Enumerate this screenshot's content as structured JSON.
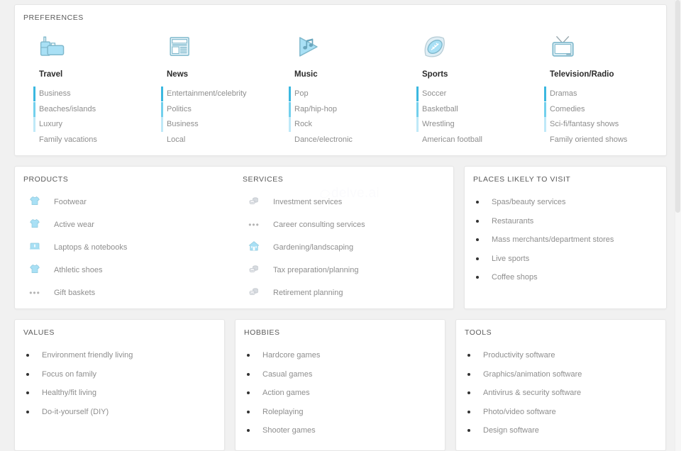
{
  "colors": {
    "page_bg": "#f1f1f1",
    "card_bg": "#ffffff",
    "accent_blue_dark": "#3bb8e0",
    "accent_blue_mid": "#73d0ed",
    "accent_blue_light": "#bfe9f8",
    "icon_blue": "#a9e0f5",
    "icon_blue_stroke": "#7fb8cc",
    "icon_gray": "#c9cdd2",
    "text_muted": "#8e8e8e",
    "title_gray": "#5a5a5a"
  },
  "preferences": {
    "title": "PREFERENCES",
    "columns": [
      {
        "icon": "suitcase-icon",
        "category": "Travel",
        "items": [
          {
            "label": "Business",
            "bar": "#3bb8e0"
          },
          {
            "label": "Beaches/islands",
            "bar": "#73d0ed"
          },
          {
            "label": "Luxury",
            "bar": "#bfe9f8"
          },
          {
            "label": "Family vacations",
            "bar": ""
          }
        ]
      },
      {
        "icon": "newspaper-icon",
        "category": "News",
        "items": [
          {
            "label": "Entertainment/celebrity",
            "bar": "#3bb8e0"
          },
          {
            "label": "Politics",
            "bar": "#73d0ed"
          },
          {
            "label": "Business",
            "bar": "#bfe9f8"
          },
          {
            "label": "Local",
            "bar": ""
          }
        ]
      },
      {
        "icon": "music-play-icon",
        "category": "Music",
        "items": [
          {
            "label": "Pop",
            "bar": "#3bb8e0"
          },
          {
            "label": "Rap/hip-hop",
            "bar": "#73d0ed"
          },
          {
            "label": "Rock",
            "bar": "#bfe9f8"
          },
          {
            "label": "Dance/electronic",
            "bar": ""
          }
        ]
      },
      {
        "icon": "football-icon",
        "category": "Sports",
        "items": [
          {
            "label": "Soccer",
            "bar": "#3bb8e0"
          },
          {
            "label": "Basketball",
            "bar": "#73d0ed"
          },
          {
            "label": "Wrestling",
            "bar": "#bfe9f8"
          },
          {
            "label": "American football",
            "bar": ""
          }
        ]
      },
      {
        "icon": "television-icon",
        "category": "Television/Radio",
        "items": [
          {
            "label": "Dramas",
            "bar": "#3bb8e0"
          },
          {
            "label": "Comedies",
            "bar": "#73d0ed"
          },
          {
            "label": "Sci-fi/fantasy shows",
            "bar": "#bfe9f8"
          },
          {
            "label": "Family oriented shows",
            "bar": ""
          }
        ]
      }
    ]
  },
  "products": {
    "title": "PRODUCTS",
    "items": [
      {
        "label": "Footwear",
        "icon": "tshirt-icon"
      },
      {
        "label": "Active wear",
        "icon": "tshirt-icon"
      },
      {
        "label": "Laptops & notebooks",
        "icon": "laptop-icon"
      },
      {
        "label": "Athletic shoes",
        "icon": "tshirt-icon"
      },
      {
        "label": "Gift baskets",
        "icon": "ellipsis-icon"
      }
    ]
  },
  "services": {
    "title": "SERVICES",
    "items": [
      {
        "label": "Investment services",
        "icon": "coins-icon"
      },
      {
        "label": "Career consulting services",
        "icon": "ellipsis-icon"
      },
      {
        "label": "Gardening/landscaping",
        "icon": "house-icon"
      },
      {
        "label": "Tax preparation/planning",
        "icon": "coins-icon"
      },
      {
        "label": "Retirement planning",
        "icon": "coins-icon"
      }
    ]
  },
  "places": {
    "title": "PLACES LIKELY TO VISIT",
    "items": [
      "Spas/beauty services",
      "Restaurants",
      "Mass merchants/department stores",
      "Live sports",
      "Coffee shops"
    ]
  },
  "values": {
    "title": "VALUES",
    "items": [
      "Environment friendly living",
      "Focus on family",
      "Healthy/fit living",
      "Do-it-yourself (DIY)"
    ]
  },
  "hobbies": {
    "title": "HOBBIES",
    "items": [
      "Hardcore games",
      "Casual games",
      "Action games",
      "Roleplaying",
      "Shooter games"
    ]
  },
  "tools": {
    "title": "TOOLS",
    "items": [
      "Productivity software",
      "Graphics/animation software",
      "Antivirus & security software",
      "Photo/video software",
      "Design software"
    ]
  },
  "watermark": {
    "text": "delve.ai"
  }
}
